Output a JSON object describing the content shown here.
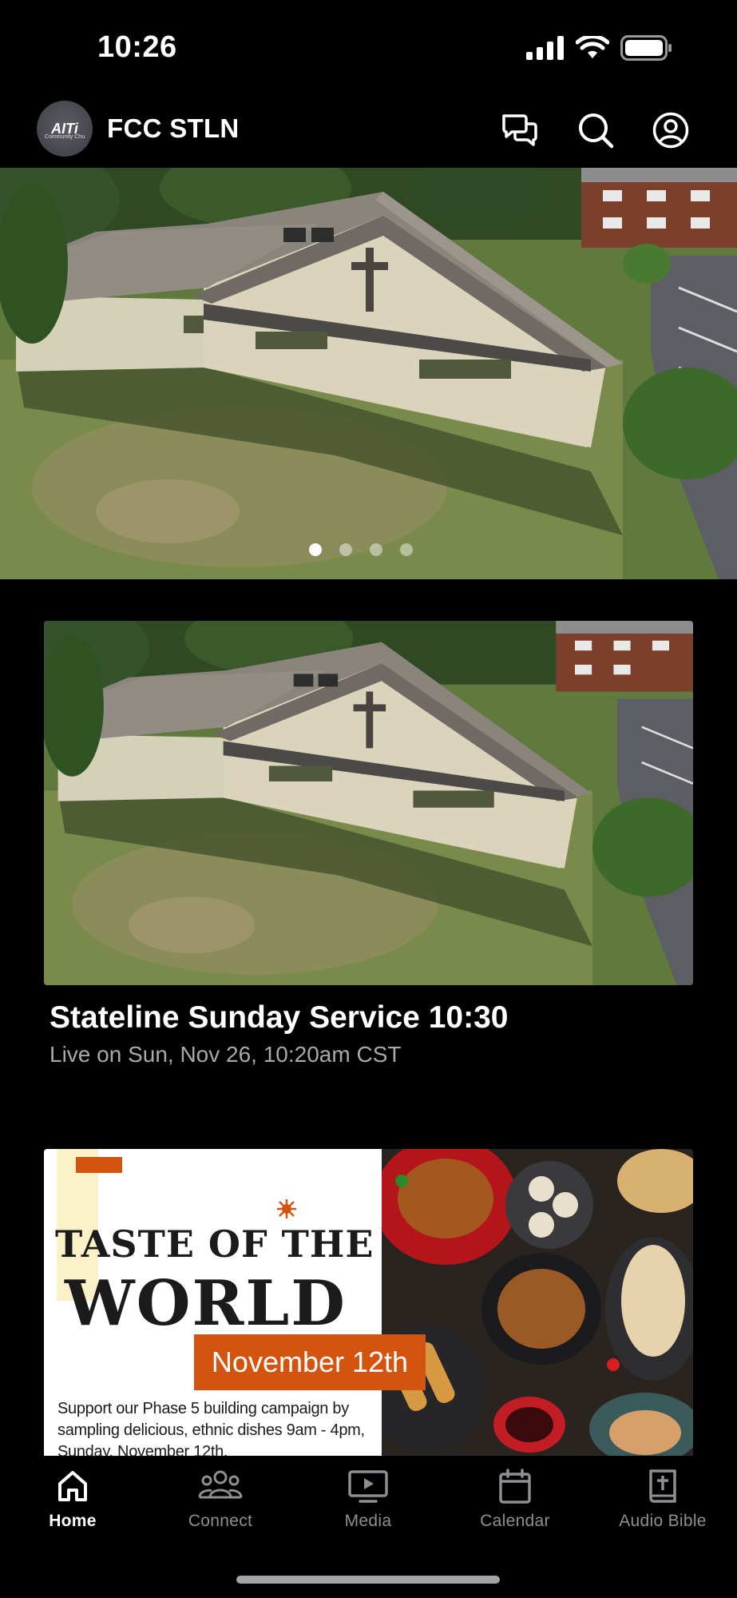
{
  "status_bar": {
    "time": "10:26",
    "icons": [
      "cellular-signal-icon",
      "wifi-icon",
      "battery-icon"
    ]
  },
  "header": {
    "logo_text": "AITi",
    "logo_subtext": "Community Chu",
    "title": "FCC STLN",
    "icons": [
      "chat-icon",
      "search-icon",
      "account-icon"
    ]
  },
  "hero": {
    "image": "aerial-church-building",
    "slides": 4,
    "active_slide": 1
  },
  "media_card": {
    "image": "aerial-church-building",
    "title": "Stateline Sunday Service 10:30",
    "subtitle": "Live on Sun, Nov 26, 10:20am CST"
  },
  "promo": {
    "title_line1": "TASTE OF THE",
    "title_line2": "WORLD",
    "date": "November 12th",
    "body": "Support our Phase 5 building campaign by sampling delicious, ethnic dishes 9am - 4pm, Sunday, November 12th.",
    "accent_color": "#d3540f"
  },
  "tab_bar": {
    "tabs": [
      {
        "label": "Home",
        "icon": "home-icon",
        "active": true
      },
      {
        "label": "Connect",
        "icon": "people-icon",
        "active": false
      },
      {
        "label": "Media",
        "icon": "media-icon",
        "active": false
      },
      {
        "label": "Calendar",
        "icon": "calendar-icon",
        "active": false
      },
      {
        "label": "Audio Bible",
        "icon": "bible-icon",
        "active": false
      }
    ]
  }
}
